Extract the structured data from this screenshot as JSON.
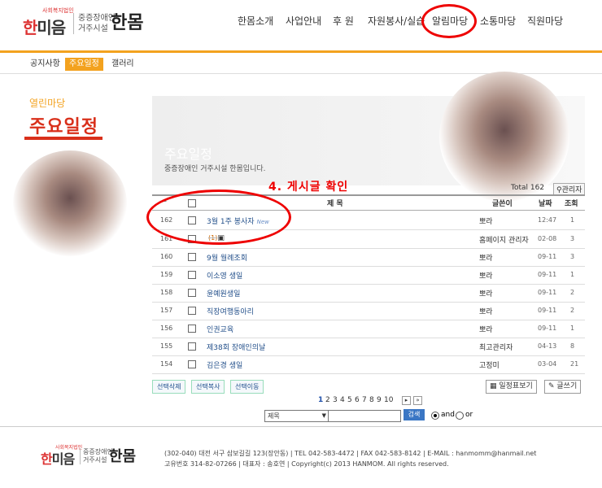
{
  "header": {
    "logo_org": "사회복지법인",
    "logo_main_a": "한",
    "logo_main_b": "미음",
    "logo_sub1": "중증장애인",
    "logo_sub2": "거주시설",
    "logo_brand": "한몸",
    "nav": [
      "한몸소개",
      "사업안내",
      "후 원",
      "자원봉사/실습",
      "알림마당",
      "소통마당",
      "직원마당"
    ]
  },
  "subnav": [
    "공지사항",
    "주요일정",
    "갤러리"
  ],
  "left": {
    "category": "열린마당",
    "title": "주요일정"
  },
  "banner": {
    "title": "주요일정",
    "desc": "중증장애인 거주시설 한몸입니다."
  },
  "board": {
    "total": "Total 162",
    "admin": "관리자",
    "annotation": "4. 게시글 확인",
    "headers": {
      "title": "제 목",
      "writer": "글쓴이",
      "date": "날짜",
      "views": "조회"
    },
    "rows": [
      {
        "num": "162",
        "title": "3월 1주 봉사자",
        "badge": "New",
        "comments": "",
        "writer": "뽀라",
        "date": "12:47",
        "views": "1"
      },
      {
        "num": "161",
        "title": "",
        "badge": "",
        "comments": "(1)",
        "writer": "홈페이지 관리자",
        "date": "02-08",
        "views": "3"
      },
      {
        "num": "160",
        "title": "9월 월례조회",
        "badge": "",
        "comments": "",
        "writer": "뽀라",
        "date": "09-11",
        "views": "3"
      },
      {
        "num": "159",
        "title": "이소영 생일",
        "badge": "",
        "comments": "",
        "writer": "뽀라",
        "date": "09-11",
        "views": "1"
      },
      {
        "num": "158",
        "title": "윤예원생일",
        "badge": "",
        "comments": "",
        "writer": "뽀라",
        "date": "09-11",
        "views": "2"
      },
      {
        "num": "157",
        "title": "직장여행동아리",
        "badge": "",
        "comments": "",
        "writer": "뽀라",
        "date": "09-11",
        "views": "2"
      },
      {
        "num": "156",
        "title": "인권교육",
        "badge": "",
        "comments": "",
        "writer": "뽀라",
        "date": "09-11",
        "views": "1"
      },
      {
        "num": "155",
        "title": "제38회 장애인의날",
        "badge": "",
        "comments": "",
        "writer": "최고관리자",
        "date": "04-13",
        "views": "8"
      },
      {
        "num": "154",
        "title": "김은경 생일",
        "badge": "",
        "comments": "",
        "writer": "고정미",
        "date": "03-04",
        "views": "21"
      }
    ],
    "buttons": [
      "선택삭제",
      "선택복사",
      "선택이동"
    ],
    "calendar_btn": "일정표보기",
    "write_btn": "글쓰기"
  },
  "pagination": [
    "1",
    "2",
    "3",
    "4",
    "5",
    "6",
    "7",
    "8",
    "9",
    "10"
  ],
  "search": {
    "field": "제목",
    "button": "검색",
    "and": "and",
    "or": "or"
  },
  "footer": {
    "logo_org": "사회복지법인",
    "logo_main_a": "한",
    "logo_main_b": "미음",
    "logo_sub1": "중증장애인",
    "logo_sub2": "거주시설",
    "logo_brand": "한몸",
    "line1": "(302-040) 대전 서구 삼보길길 123(장안동)  |  TEL 042-583-4472  |  FAX 042-583-8142  |  E-MAIL : hanmomm@hanmail.net",
    "line2": "고유번호 314-82-07266  |  대표자 : 송호연  |  Copyright(c) 2013 HANMOM. All rights reserved."
  }
}
